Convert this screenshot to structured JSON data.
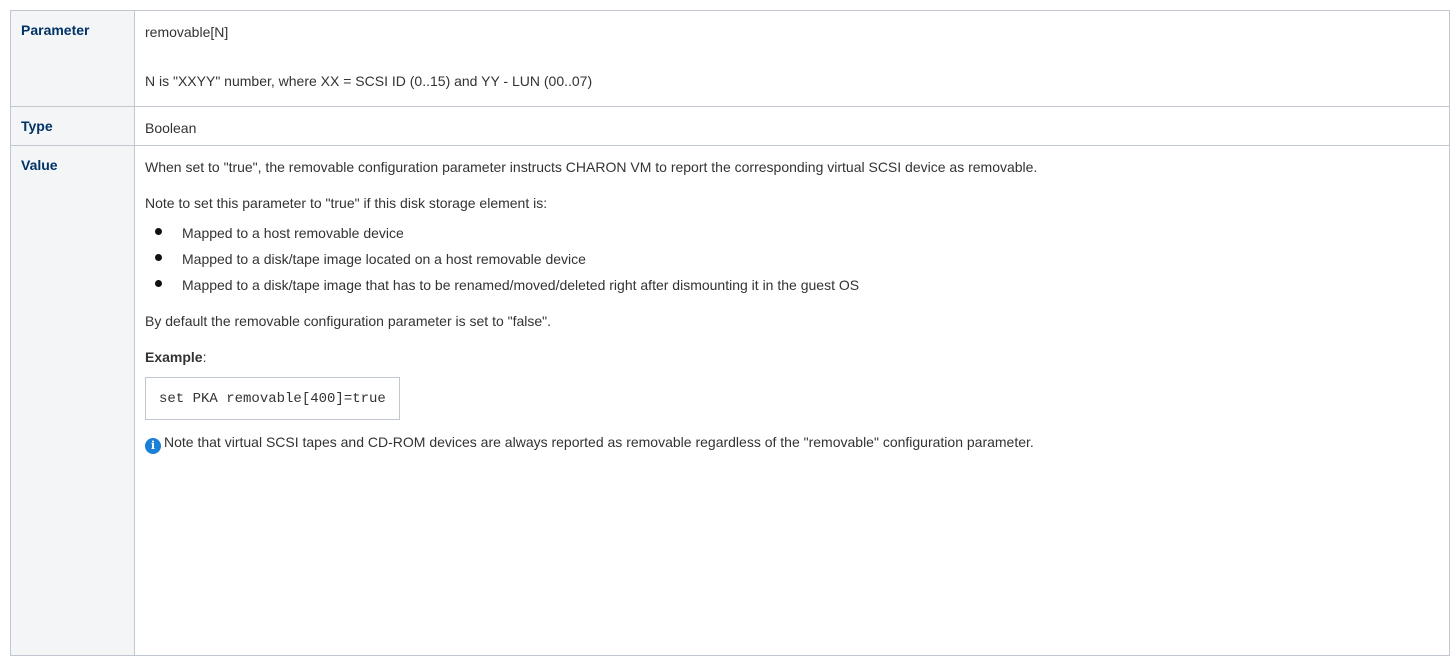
{
  "table": {
    "rows": {
      "parameter": {
        "label": "Parameter",
        "value": "removable[N]",
        "description": "N is \"XXYY\" number, where XX = SCSI ID (0..15) and YY - LUN (00..07)"
      },
      "type": {
        "label": "Type",
        "value": "Boolean"
      },
      "value": {
        "label": "Value",
        "intro": "When set to \"true\", the removable configuration parameter instructs CHARON VM to report the corresponding virtual SCSI device as removable.",
        "note_intro": "Note to set this parameter to \"true\" if this disk storage element is:",
        "bullets": [
          "Mapped to a host removable device",
          "Mapped to a disk/tape image located on a host removable device",
          "Mapped to a disk/tape image that has to be renamed/moved/deleted right after dismounting it in the guest OS"
        ],
        "default_text": "By default the removable configuration parameter is set to \"false\".",
        "example_label": "Example",
        "example_suffix": ":",
        "example_code": "set PKA removable[400]=true",
        "info_note": "Note that virtual SCSI tapes and CD-ROM devices are always reported as removable regardless of the \"removable\" configuration parameter.",
        "info_icon": "info-icon"
      }
    }
  },
  "colors": {
    "header_bg": "#f4f5f7",
    "header_text": "#003366",
    "border": "#c1c7d0",
    "info_icon": "#1a7fd6"
  }
}
